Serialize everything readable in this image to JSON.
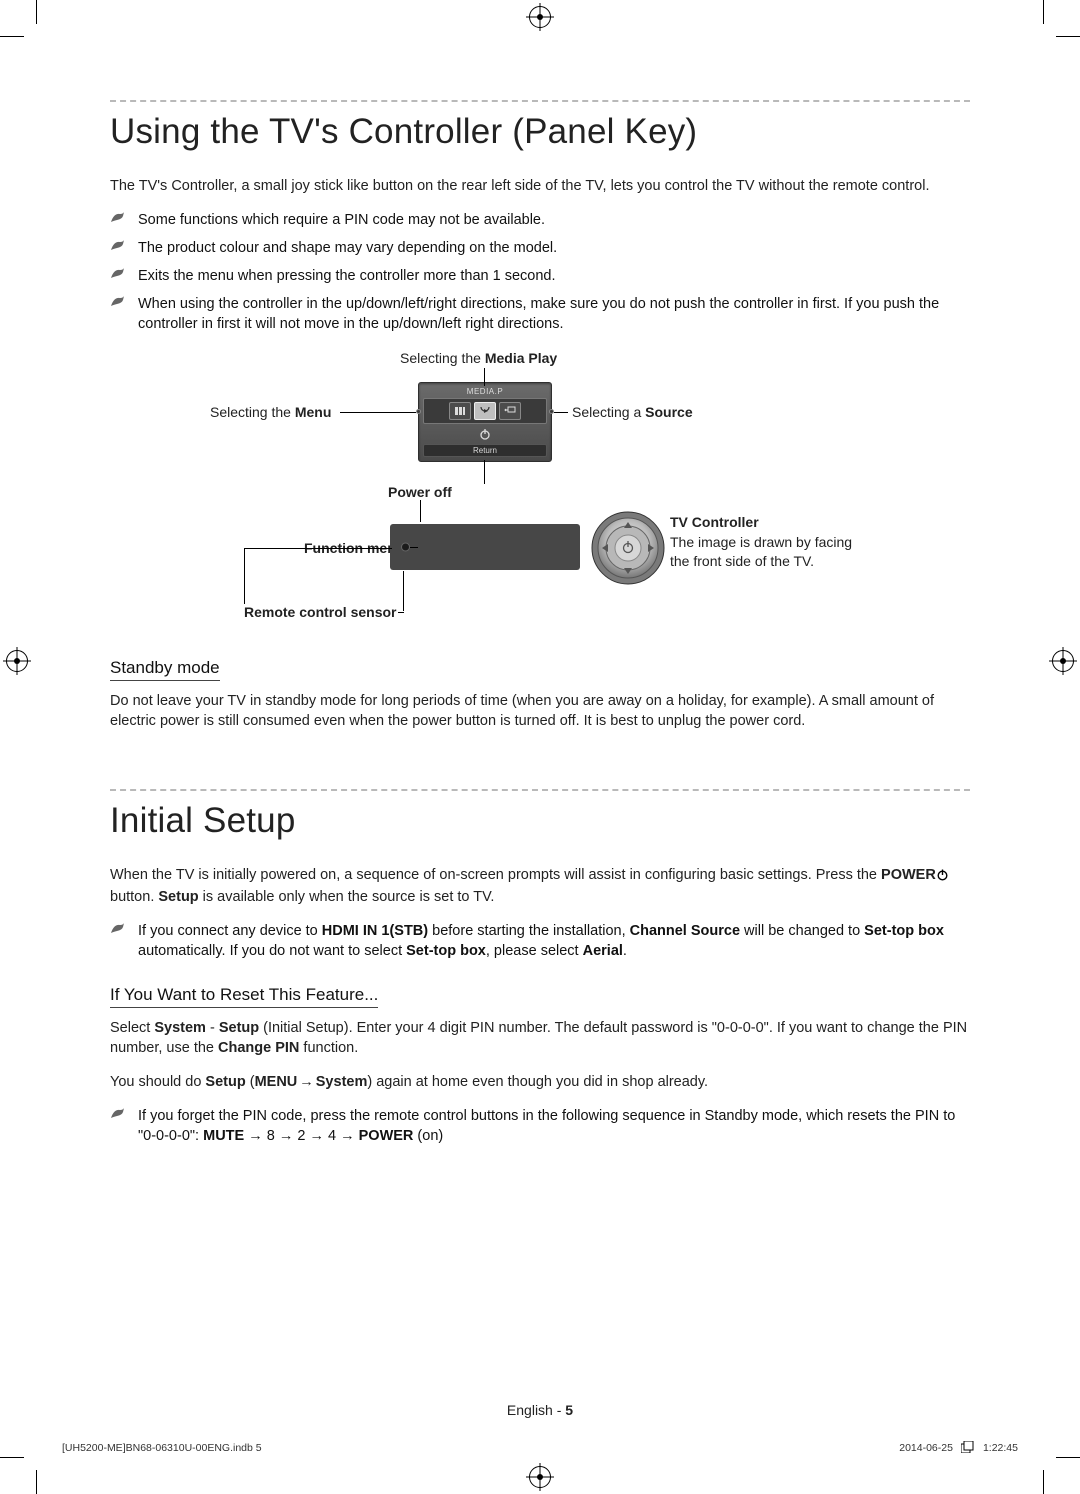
{
  "section1": {
    "heading": "Using the TV's Controller (Panel Key)",
    "intro": "The TV's Controller, a small joy stick like button on the rear left side of the TV, lets you control the TV without the remote control.",
    "notes": [
      "Some functions which require a PIN code may not be available.",
      "The product colour and shape may vary depending on the model.",
      "Exits the menu when pressing the controller more than 1 second.",
      "When using the controller in the up/down/left/right directions, make sure you do not push the controller in first. If you push the controller in first it will not move in the up/down/left right directions."
    ],
    "diagram": {
      "selecting_media_play_pre": "Selecting the ",
      "selecting_media_play_bold": "Media Play",
      "selecting_menu_pre": "Selecting the ",
      "selecting_menu_bold": "Menu",
      "selecting_source_pre": "Selecting a ",
      "selecting_source_bold": "Source",
      "popup_title": "MEDIA.P",
      "popup_return": "Return",
      "power_off": "Power off",
      "function_menu": "Function menu",
      "tv_controller": "TV Controller",
      "tv_controller_caption": "The image is drawn by facing the front side of the TV.",
      "remote_sensor": "Remote control sensor"
    },
    "subheading": "Standby mode",
    "standby_text": "Do not leave your TV in standby mode for long periods of time (when you are away on a holiday, for example). A small amount of electric power is still consumed even when the power button is turned off. It is best to unplug the power cord."
  },
  "section2": {
    "heading": "Initial Setup",
    "intro_pre": "When the TV is initially powered on, a sequence of on-screen prompts will assist in configuring basic settings. Press the ",
    "intro_power": "POWER",
    "intro_mid": " button. ",
    "intro_setup": "Setup",
    "intro_post": " is available only when the source is set to TV.",
    "note_pre": "If you connect any device to ",
    "note_hdmi": "HDMI IN 1(STB)",
    "note_mid1": " before starting the installation, ",
    "note_channel_source": "Channel Source",
    "note_mid2": " will be changed to ",
    "note_stb": "Set-top box",
    "note_mid3": " automatically. If you do not want to select ",
    "note_stb2": "Set-top box",
    "note_mid4": ", please select ",
    "note_aerial": "Aerial",
    "note_period": ".",
    "subheading": "If You Want to Reset This Feature...",
    "reset_p1_pre": "Select ",
    "reset_p1_system": "System",
    "reset_p1_dash": " - ",
    "reset_p1_setup": "Setup",
    "reset_p1_mid": " (Initial Setup). Enter your 4 digit PIN number. The default password is \"0-0-0-0\". If you want to change the PIN number, use the ",
    "reset_p1_changepin": "Change PIN",
    "reset_p1_post": " function.",
    "reset_p2_pre": "You should do ",
    "reset_p2_setup": "Setup",
    "reset_p2_open": " (",
    "reset_p2_menu": "MENU",
    "reset_p2_arrow": " → ",
    "reset_p2_system": "System",
    "reset_p2_close": ") again at home even though you did in shop already.",
    "reset_note_pre": "If you forget the PIN code, press the remote control buttons in the following sequence in Standby mode, which resets the PIN to \"0-0-0-0\": ",
    "reset_note_mute": "MUTE",
    "reset_note_seq1": " → 8 → 2 → 4 → ",
    "reset_note_power": "POWER",
    "reset_note_post": " (on)"
  },
  "footer": {
    "lang_pre": "English - ",
    "lang_num": "5",
    "print_file": "[UH5200-ME]BN68-06310U-00ENG.indb   5",
    "print_date": "2014-06-25   ",
    "print_time": "1:22:45"
  }
}
